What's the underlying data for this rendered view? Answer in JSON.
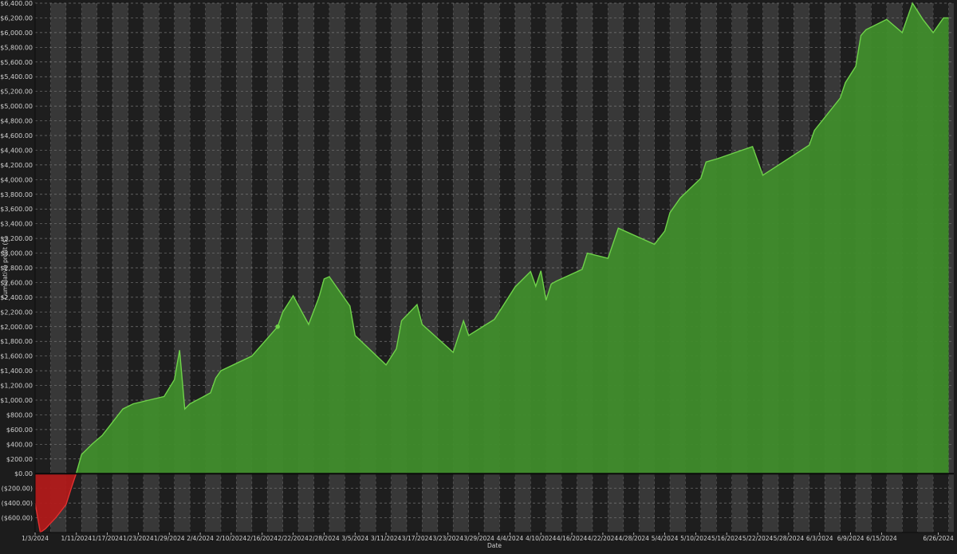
{
  "chart_data": {
    "type": "area",
    "xlabel": "Date",
    "ylabel": "Cumulative profit ($)",
    "ylim": [
      -800,
      6400
    ],
    "y_ticks": [
      -600,
      -400,
      -200,
      0,
      200,
      400,
      600,
      800,
      1000,
      1200,
      1400,
      1600,
      1800,
      2000,
      2200,
      2400,
      2600,
      2800,
      3000,
      3200,
      3400,
      3600,
      3800,
      4000,
      4200,
      4400,
      4600,
      4800,
      5000,
      5200,
      5400,
      5600,
      5800,
      6000,
      6200,
      6400
    ],
    "y_tick_labels": [
      "($600.00)",
      "($400.00)",
      "($200.00)",
      "$0.00",
      "$200.00",
      "$400.00",
      "$600.00",
      "$800.00",
      "$1,000.00",
      "$1,200.00",
      "$1,400.00",
      "$1,600.00",
      "$1,800.00",
      "$2,000.00",
      "$2,200.00",
      "$2,400.00",
      "$2,600.00",
      "$2,800.00",
      "$3,000.00",
      "$3,200.00",
      "$3,400.00",
      "$3,600.00",
      "$3,800.00",
      "$4,000.00",
      "$4,200.00",
      "$4,400.00",
      "$4,600.00",
      "$4,800.00",
      "$5,000.00",
      "$5,200.00",
      "$5,400.00",
      "$5,600.00",
      "$5,800.00",
      "$6,000.00",
      "$6,200.00",
      "$6,400.00"
    ],
    "xlim": [
      "2024-01-03",
      "2024-06-29"
    ],
    "x_ticks": [
      "2024-01-03",
      "2024-01-11",
      "2024-01-17",
      "2024-01-23",
      "2024-01-29",
      "2024-02-04",
      "2024-02-10",
      "2024-02-16",
      "2024-02-22",
      "2024-02-28",
      "2024-03-05",
      "2024-03-11",
      "2024-03-17",
      "2024-03-23",
      "2024-03-29",
      "2024-04-04",
      "2024-04-10",
      "2024-04-16",
      "2024-04-22",
      "2024-04-28",
      "2024-05-04",
      "2024-05-10",
      "2024-05-16",
      "2024-05-22",
      "2024-05-28",
      "2024-06-03",
      "2024-06-09",
      "2024-06-15",
      "2024-06-26"
    ],
    "x_tick_labels": [
      "1/3/2024",
      "1/11/2024",
      "1/17/2024",
      "1/23/2024",
      "1/29/2024",
      "2/4/2024",
      "2/10/2024",
      "2/16/2024",
      "2/22/2024",
      "2/28/2024",
      "3/5/2024",
      "3/11/2024",
      "3/17/2024",
      "3/23/2024",
      "3/29/2024",
      "4/4/2024",
      "4/10/2024",
      "4/16/2024",
      "4/22/2024",
      "4/28/2024",
      "5/4/2024",
      "5/10/2024",
      "5/16/2024",
      "5/22/2024",
      "5/28/2024",
      "6/3/2024",
      "6/9/2024",
      "6/15/2024",
      "6/26/2024"
    ],
    "grid": true,
    "legend": "none",
    "colors": {
      "positive_fill": "#3f8c2b",
      "positive_line": "#6fd24a",
      "negative_fill": "#b01a1a",
      "negative_line": "#e03030",
      "zero_line": "#0a0a0a",
      "band_dark": "#1e1e1e",
      "band_light": "#383838",
      "grid": "#8a8a8a",
      "text": "#d0d0d0"
    },
    "series": [
      {
        "x": [
          "2024-01-03",
          "2024-01-04",
          "2024-01-05",
          "2024-01-07",
          "2024-01-09",
          "2024-01-10",
          "2024-01-11",
          "2024-01-12",
          "2024-01-14",
          "2024-01-16",
          "2024-01-18",
          "2024-01-20",
          "2024-01-22",
          "2024-01-25",
          "2024-01-28",
          "2024-01-30",
          "2024-01-31",
          "2024-02-01",
          "2024-02-02",
          "2024-02-06",
          "2024-02-07",
          "2024-02-08",
          "2024-02-14",
          "2024-02-19",
          "2024-02-20",
          "2024-02-22",
          "2024-02-25",
          "2024-02-27",
          "2024-02-28",
          "2024-02-29",
          "2024-03-04",
          "2024-03-05",
          "2024-03-11",
          "2024-03-13",
          "2024-03-14",
          "2024-03-17",
          "2024-03-18",
          "2024-03-24",
          "2024-03-26",
          "2024-03-27",
          "2024-04-01",
          "2024-04-05",
          "2024-04-08",
          "2024-04-09",
          "2024-04-10",
          "2024-04-11",
          "2024-04-12",
          "2024-04-13",
          "2024-04-18",
          "2024-04-19",
          "2024-04-23",
          "2024-04-25",
          "2024-05-02",
          "2024-05-04",
          "2024-05-05",
          "2024-05-07",
          "2024-05-11",
          "2024-05-12",
          "2024-05-14",
          "2024-05-21",
          "2024-05-23",
          "2024-06-01",
          "2024-06-02",
          "2024-06-07",
          "2024-06-08",
          "2024-06-10",
          "2024-06-11",
          "2024-06-12",
          "2024-06-16",
          "2024-06-19",
          "2024-06-21",
          "2024-06-23",
          "2024-06-25",
          "2024-06-26",
          "2024-06-27",
          "2024-06-28"
        ],
        "y": [
          -400,
          -800,
          -750,
          -600,
          -420,
          -200,
          10,
          260,
          400,
          520,
          700,
          880,
          950,
          1000,
          1050,
          1280,
          1680,
          880,
          950,
          1100,
          1300,
          1400,
          1600,
          2000,
          2200,
          2420,
          2030,
          2400,
          2650,
          2680,
          2280,
          1880,
          1480,
          1700,
          2080,
          2300,
          2030,
          1650,
          2080,
          1880,
          2100,
          2540,
          2750,
          2550,
          2760,
          2360,
          2580,
          2620,
          2780,
          3000,
          2930,
          3340,
          3120,
          3300,
          3550,
          3750,
          4020,
          4240,
          4280,
          4450,
          4060,
          4470,
          4670,
          5110,
          5320,
          5540,
          5960,
          6040,
          6180,
          6000,
          6400,
          6180,
          6000,
          6100,
          6200,
          6200
        ]
      }
    ],
    "highlight_point": {
      "x": "2024-02-19",
      "y": 2000
    }
  }
}
